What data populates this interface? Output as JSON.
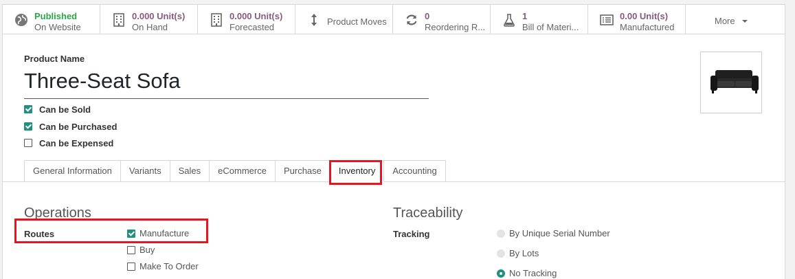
{
  "smart_buttons": [
    {
      "icon": "globe-icon",
      "value": "Published",
      "label": "On Website"
    },
    {
      "icon": "building-icon",
      "value": "0.000 Unit(s)",
      "label": "On Hand"
    },
    {
      "icon": "building-icon",
      "value": "0.000 Unit(s)",
      "label": "Forecasted"
    },
    {
      "icon": "arrows-vertical-icon",
      "label": "Product Moves"
    },
    {
      "icon": "refresh-icon",
      "value": "0",
      "label": "Reordering R..."
    },
    {
      "icon": "flask-icon",
      "value": "1",
      "label": "Bill of Materi..."
    },
    {
      "icon": "list-icon",
      "value": "0.00 Unit(s)",
      "label": "Manufactured"
    }
  ],
  "more_label": "More",
  "product": {
    "name_label": "Product Name",
    "name": "Three-Seat Sofa",
    "image_alt": "sofa"
  },
  "checkboxes": [
    {
      "label": "Can be Sold",
      "checked": true
    },
    {
      "label": "Can be Purchased",
      "checked": true
    },
    {
      "label": "Can be Expensed",
      "checked": false
    }
  ],
  "tabs": [
    "General Information",
    "Variants",
    "Sales",
    "eCommerce",
    "Purchase",
    "Inventory",
    "Accounting"
  ],
  "active_tab": "Inventory",
  "operations": {
    "title": "Operations",
    "routes_label": "Routes",
    "routes": [
      {
        "label": "Manufacture",
        "checked": true
      },
      {
        "label": "Buy",
        "checked": false
      },
      {
        "label": "Make To Order",
        "checked": false
      }
    ]
  },
  "traceability": {
    "title": "Traceability",
    "tracking_label": "Tracking",
    "options": [
      {
        "label": "By Unique Serial Number",
        "selected": false
      },
      {
        "label": "By Lots",
        "selected": false
      },
      {
        "label": "No Tracking",
        "selected": true
      }
    ]
  },
  "colors": {
    "accent": "#875a7b",
    "published": "#28a745",
    "check": "#21917f",
    "highlight": "#e8141f"
  }
}
